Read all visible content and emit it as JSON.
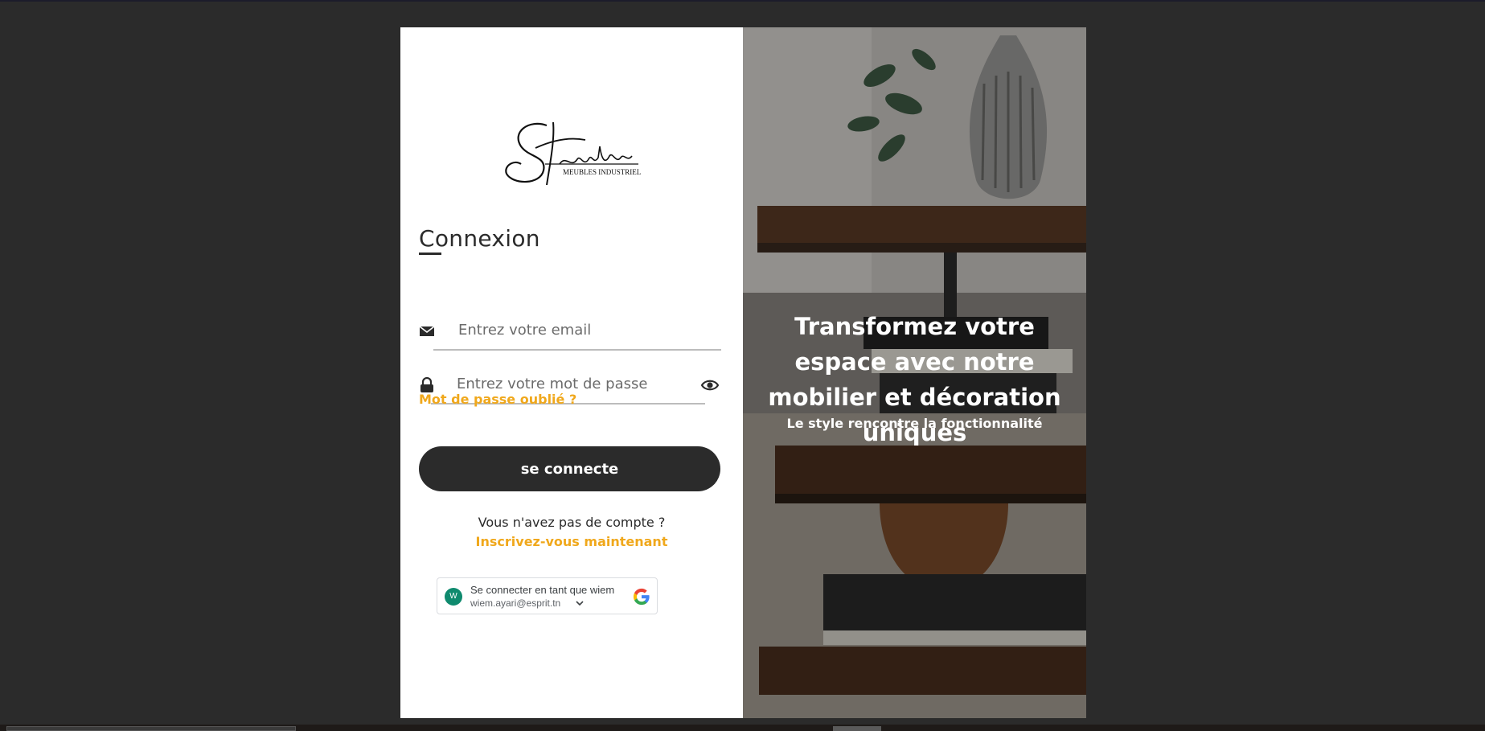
{
  "brand": {
    "logo_script": "Steelisia",
    "logo_tagline": "MEUBLES INDUSTRIEL"
  },
  "login": {
    "heading": "Connexion",
    "email_placeholder": "Entrez votre email",
    "password_placeholder": "Entrez votre mot de passe",
    "forgot_password": "Mot de passe oublié ?",
    "submit_label": "se connecte",
    "no_account_text": "Vous n'avez pas de compte ?",
    "signup_link": "Inscrivez-vous maintenant"
  },
  "google_signin": {
    "avatar_letter": "W",
    "title": "Se connecter en tant que wiem",
    "email": "wiem.ayari@esprit.tn"
  },
  "hero": {
    "title": "Transformez votre espace avec notre mobilier et décoration uniques",
    "subtitle": "Le style rencontre la fonctionnalité"
  },
  "colors": {
    "accent": "#f0a81c",
    "dark": "#2b2b2b",
    "background": "#2b2b2b"
  }
}
